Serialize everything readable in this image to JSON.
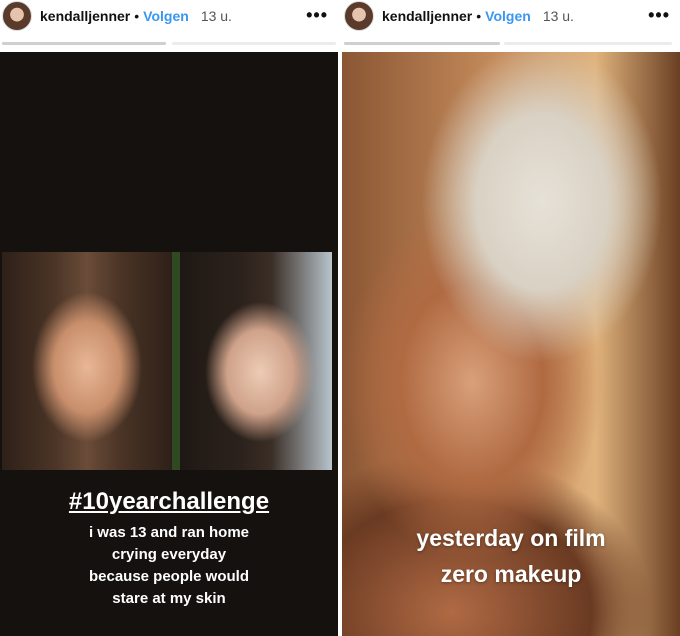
{
  "stories": [
    {
      "username": "kendalljenner",
      "separator": "•",
      "follow_label": "Volgen",
      "time": "13 u.",
      "more_label": "•••",
      "progress": [
        1.0,
        0.0
      ],
      "title": "#10yearchallenge",
      "lines": [
        "i was 13 and ran home",
        "crying everyday",
        "because people would",
        "stare at my skin"
      ]
    },
    {
      "username": "kendalljenner",
      "separator": "•",
      "follow_label": "Volgen",
      "time": "13 u.",
      "more_label": "•••",
      "progress": [
        1.0,
        0.0
      ],
      "lines": [
        "yesterday on film",
        "zero makeup"
      ]
    }
  ],
  "colors": {
    "follow": "#3897f0",
    "progress": "#cfcfcf",
    "left_background": "#15110e"
  }
}
